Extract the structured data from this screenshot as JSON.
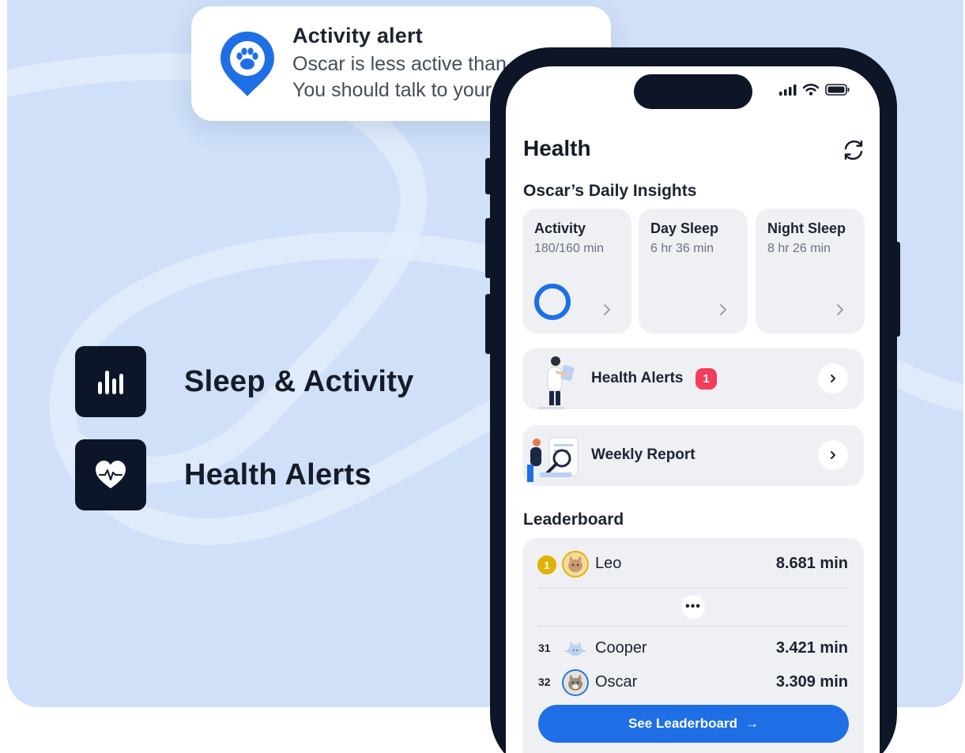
{
  "notification": {
    "title": "Activity alert",
    "body": "Oscar is less active than usual. You should talk to your vet.",
    "icon": "paw-location-pin-icon"
  },
  "features": [
    {
      "label": "Sleep & Activity",
      "icon": "bar-chart-icon"
    },
    {
      "label": "Health Alerts",
      "icon": "heart-pulse-icon"
    }
  ],
  "app": {
    "title": "Health",
    "refresh_icon": "refresh-icon",
    "insights_title": "Oscar’s Daily Insights",
    "insights": [
      {
        "title": "Activity",
        "value": "180/160 min",
        "progress": 1.0
      },
      {
        "title": "Day Sleep",
        "value": "6 hr 36 min"
      },
      {
        "title": "Night Sleep",
        "value": "8 hr 26 min"
      }
    ],
    "health_alerts": {
      "label": "Health Alerts",
      "badge": "1"
    },
    "weekly_report": {
      "label": "Weekly Report"
    },
    "leaderboard": {
      "title": "Leaderboard",
      "rows": [
        {
          "rank": "1",
          "name": "Leo",
          "value": "8.681 min"
        },
        {
          "rank": "31",
          "name": "Cooper",
          "value": "3.421 min"
        },
        {
          "rank": "32",
          "name": "Oscar",
          "value": "3.309 min"
        }
      ],
      "more_label": "•••",
      "cta_label": "See Leaderboard",
      "cta_arrow": "→"
    }
  },
  "colors": {
    "accent": "#1e6fe6",
    "badge": "#f23d5c",
    "gold": "#e0b200",
    "background": "#cfe0f8",
    "dark": "#0d1526"
  }
}
